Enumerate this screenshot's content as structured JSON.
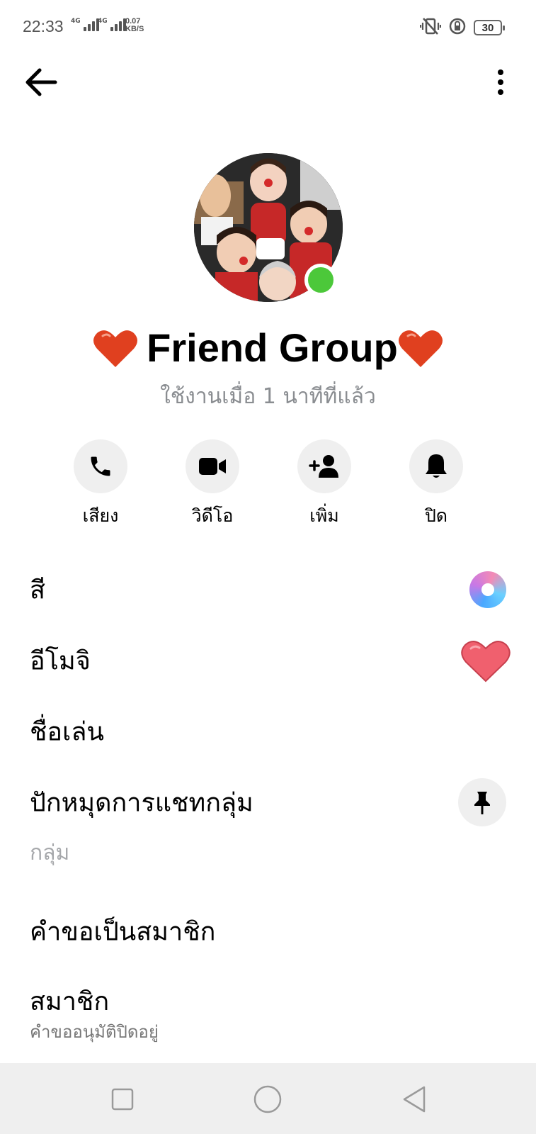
{
  "status_bar": {
    "time": "22:33",
    "signal1_label": "4G",
    "signal2_label": "4G",
    "speed_value": "0.07",
    "speed_unit": "KB/S",
    "battery": "30"
  },
  "header": {
    "back_icon": "arrow-left-icon",
    "more_icon": "vertical-dots-icon"
  },
  "profile": {
    "name": "Friend Group",
    "active_status": "ใช้งานเมื่อ 1 นาทีที่แล้ว",
    "online": true,
    "online_color": "#4cc83a"
  },
  "actions": [
    {
      "label": "เสียง",
      "icon": "phone-icon"
    },
    {
      "label": "วิดีโอ",
      "icon": "video-camera-icon"
    },
    {
      "label": "เพิ่ม",
      "icon": "add-person-icon"
    },
    {
      "label": "ปิด",
      "icon": "bell-icon"
    }
  ],
  "settings": {
    "color_label": "สี",
    "emoji_label": "อีโมจิ",
    "nickname_label": "ชื่อเล่น",
    "pin_label": "ปักหมุดการแชทกลุ่ม",
    "group_section": "กลุ่ม",
    "membership_requests_label": "คำขอเป็นสมาชิก",
    "members_label": "สมาชิก",
    "members_sub": "คำขออนุมัติปิดอยู่"
  },
  "colors": {
    "emoji_heart": "#f0606e",
    "icon_bg": "#efefef",
    "secondary_text": "#8a8d91"
  }
}
